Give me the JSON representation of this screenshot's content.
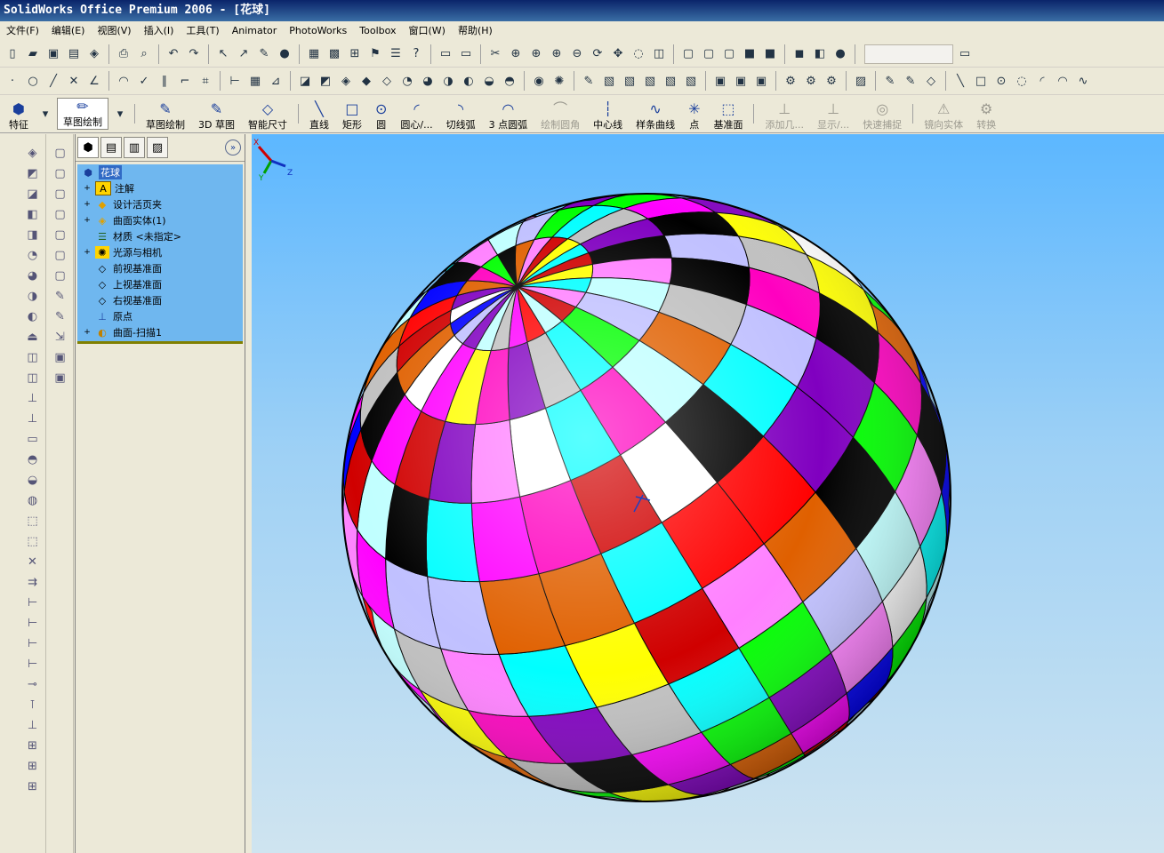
{
  "window": {
    "title": "SolidWorks Office Premium 2006 - [花球]"
  },
  "menu": [
    "文件(F)",
    "编辑(E)",
    "视图(V)",
    "插入(I)",
    "工具(T)",
    "Animator",
    "PhotoWorks",
    "Toolbox",
    "窗口(W)",
    "帮助(H)"
  ],
  "command_manager": {
    "items": [
      {
        "label": "特征",
        "icon": "feature-icon",
        "enabled": true
      },
      {
        "label": "草图绘制",
        "icon": "sketch-icon",
        "enabled": true,
        "active": true
      },
      {
        "label": "草图绘制",
        "icon": "sketch-pencil-icon",
        "enabled": true
      },
      {
        "label": "3D 草图",
        "icon": "3d-sketch-icon",
        "enabled": true
      },
      {
        "label": "智能尺寸",
        "icon": "smart-dimension-icon",
        "enabled": true
      },
      {
        "label": "直线",
        "icon": "line-icon",
        "enabled": true
      },
      {
        "label": "矩形",
        "icon": "rectangle-icon",
        "enabled": true
      },
      {
        "label": "圆",
        "icon": "circle-icon",
        "enabled": true
      },
      {
        "label": "圆心/...",
        "icon": "center-arc-icon",
        "enabled": true
      },
      {
        "label": "切线弧",
        "icon": "tangent-arc-icon",
        "enabled": true
      },
      {
        "label": "3 点圆弧",
        "icon": "three-point-arc-icon",
        "enabled": true
      },
      {
        "label": "绘制圆角",
        "icon": "sketch-fillet-icon",
        "enabled": false
      },
      {
        "label": "中心线",
        "icon": "centerline-icon",
        "enabled": true
      },
      {
        "label": "样条曲线",
        "icon": "spline-icon",
        "enabled": true
      },
      {
        "label": "点",
        "icon": "point-icon",
        "enabled": true
      },
      {
        "label": "基准面",
        "icon": "plane-icon",
        "enabled": true
      },
      {
        "label": "添加几...",
        "icon": "add-relation-icon",
        "enabled": false
      },
      {
        "label": "显示/...",
        "icon": "display-relation-icon",
        "enabled": false
      },
      {
        "label": "快速捕捉",
        "icon": "quick-snap-icon",
        "enabled": false
      },
      {
        "label": "镜向实体",
        "icon": "mirror-entities-icon",
        "enabled": false
      },
      {
        "label": "转换",
        "icon": "convert-entities-icon",
        "enabled": false
      }
    ]
  },
  "feature_tree": {
    "root": "花球",
    "items": [
      {
        "label": "注解",
        "icon": "annotations-icon",
        "expandable": true
      },
      {
        "label": "设计活页夹",
        "icon": "design-binder-icon",
        "expandable": true
      },
      {
        "label": "曲面实体(1)",
        "icon": "surface-bodies-icon",
        "expandable": true
      },
      {
        "label": "材质 <未指定>",
        "icon": "material-icon",
        "expandable": false
      },
      {
        "label": "光源与相机",
        "icon": "lights-cameras-icon",
        "expandable": true
      },
      {
        "label": "前视基准面",
        "icon": "plane-icon",
        "expandable": false
      },
      {
        "label": "上视基准面",
        "icon": "plane-icon",
        "expandable": false
      },
      {
        "label": "右视基准面",
        "icon": "plane-icon",
        "expandable": false
      },
      {
        "label": "原点",
        "icon": "origin-icon",
        "expandable": false
      },
      {
        "label": "曲面-扫描1",
        "icon": "sweep-surface-icon",
        "expandable": true
      }
    ]
  },
  "model": {
    "palette": [
      "#ff0000",
      "#ffff00",
      "#00ff00",
      "#0000ff",
      "#ff00ff",
      "#00ffff",
      "#000000",
      "#ffffff",
      "#c0c0c0",
      "#ff80ff",
      "#e06000",
      "#8000c0",
      "#c0ffff",
      "#d00000",
      "#ff00c0",
      "#c0c0ff"
    ]
  },
  "triad": {
    "x": "X",
    "y": "Y",
    "z": "Z"
  }
}
